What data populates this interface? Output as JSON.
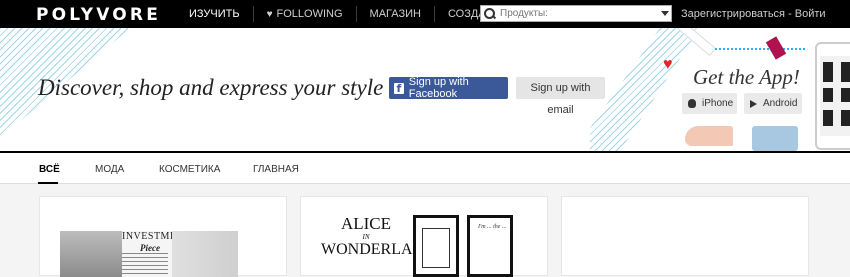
{
  "header": {
    "logo": "POLYVORE",
    "nav": [
      {
        "label": "ИЗУЧИТЬ",
        "active": true
      },
      {
        "label": "FOLLOWING",
        "icon": "heart-icon"
      },
      {
        "label": "МАГАЗИН"
      },
      {
        "label": "СОЗДАТЬ"
      }
    ],
    "search": {
      "placeholder": "Продукты:"
    },
    "auth": "Зарегистрироваться - Войти"
  },
  "hero": {
    "tagline": "Discover, shop and express your style",
    "facebook_button": "Sign up with Facebook",
    "facebook_glyph": "f",
    "email_button": "Sign up with email",
    "app_title": "Get the App!",
    "iphone_button": "iPhone",
    "android_button": "Android"
  },
  "tabs": [
    {
      "label": "ВСЁ",
      "active": true
    },
    {
      "label": "МОДА"
    },
    {
      "label": "КОСМЕТИКА"
    },
    {
      "label": "ГЛАВНАЯ"
    }
  ],
  "cards": {
    "card1": {
      "title": "INVESTMENT",
      "subtitle": "Piece"
    },
    "card2": {
      "line1": "ALICE",
      "line2": "IN",
      "line3": "WONDERLAND",
      "frame_text": "I'm ... the ..."
    }
  },
  "colors": {
    "topbar": "#000000",
    "facebook": "#3b5998",
    "accent_blue": "#2ab0e6",
    "heart_red": "#e4232b"
  }
}
